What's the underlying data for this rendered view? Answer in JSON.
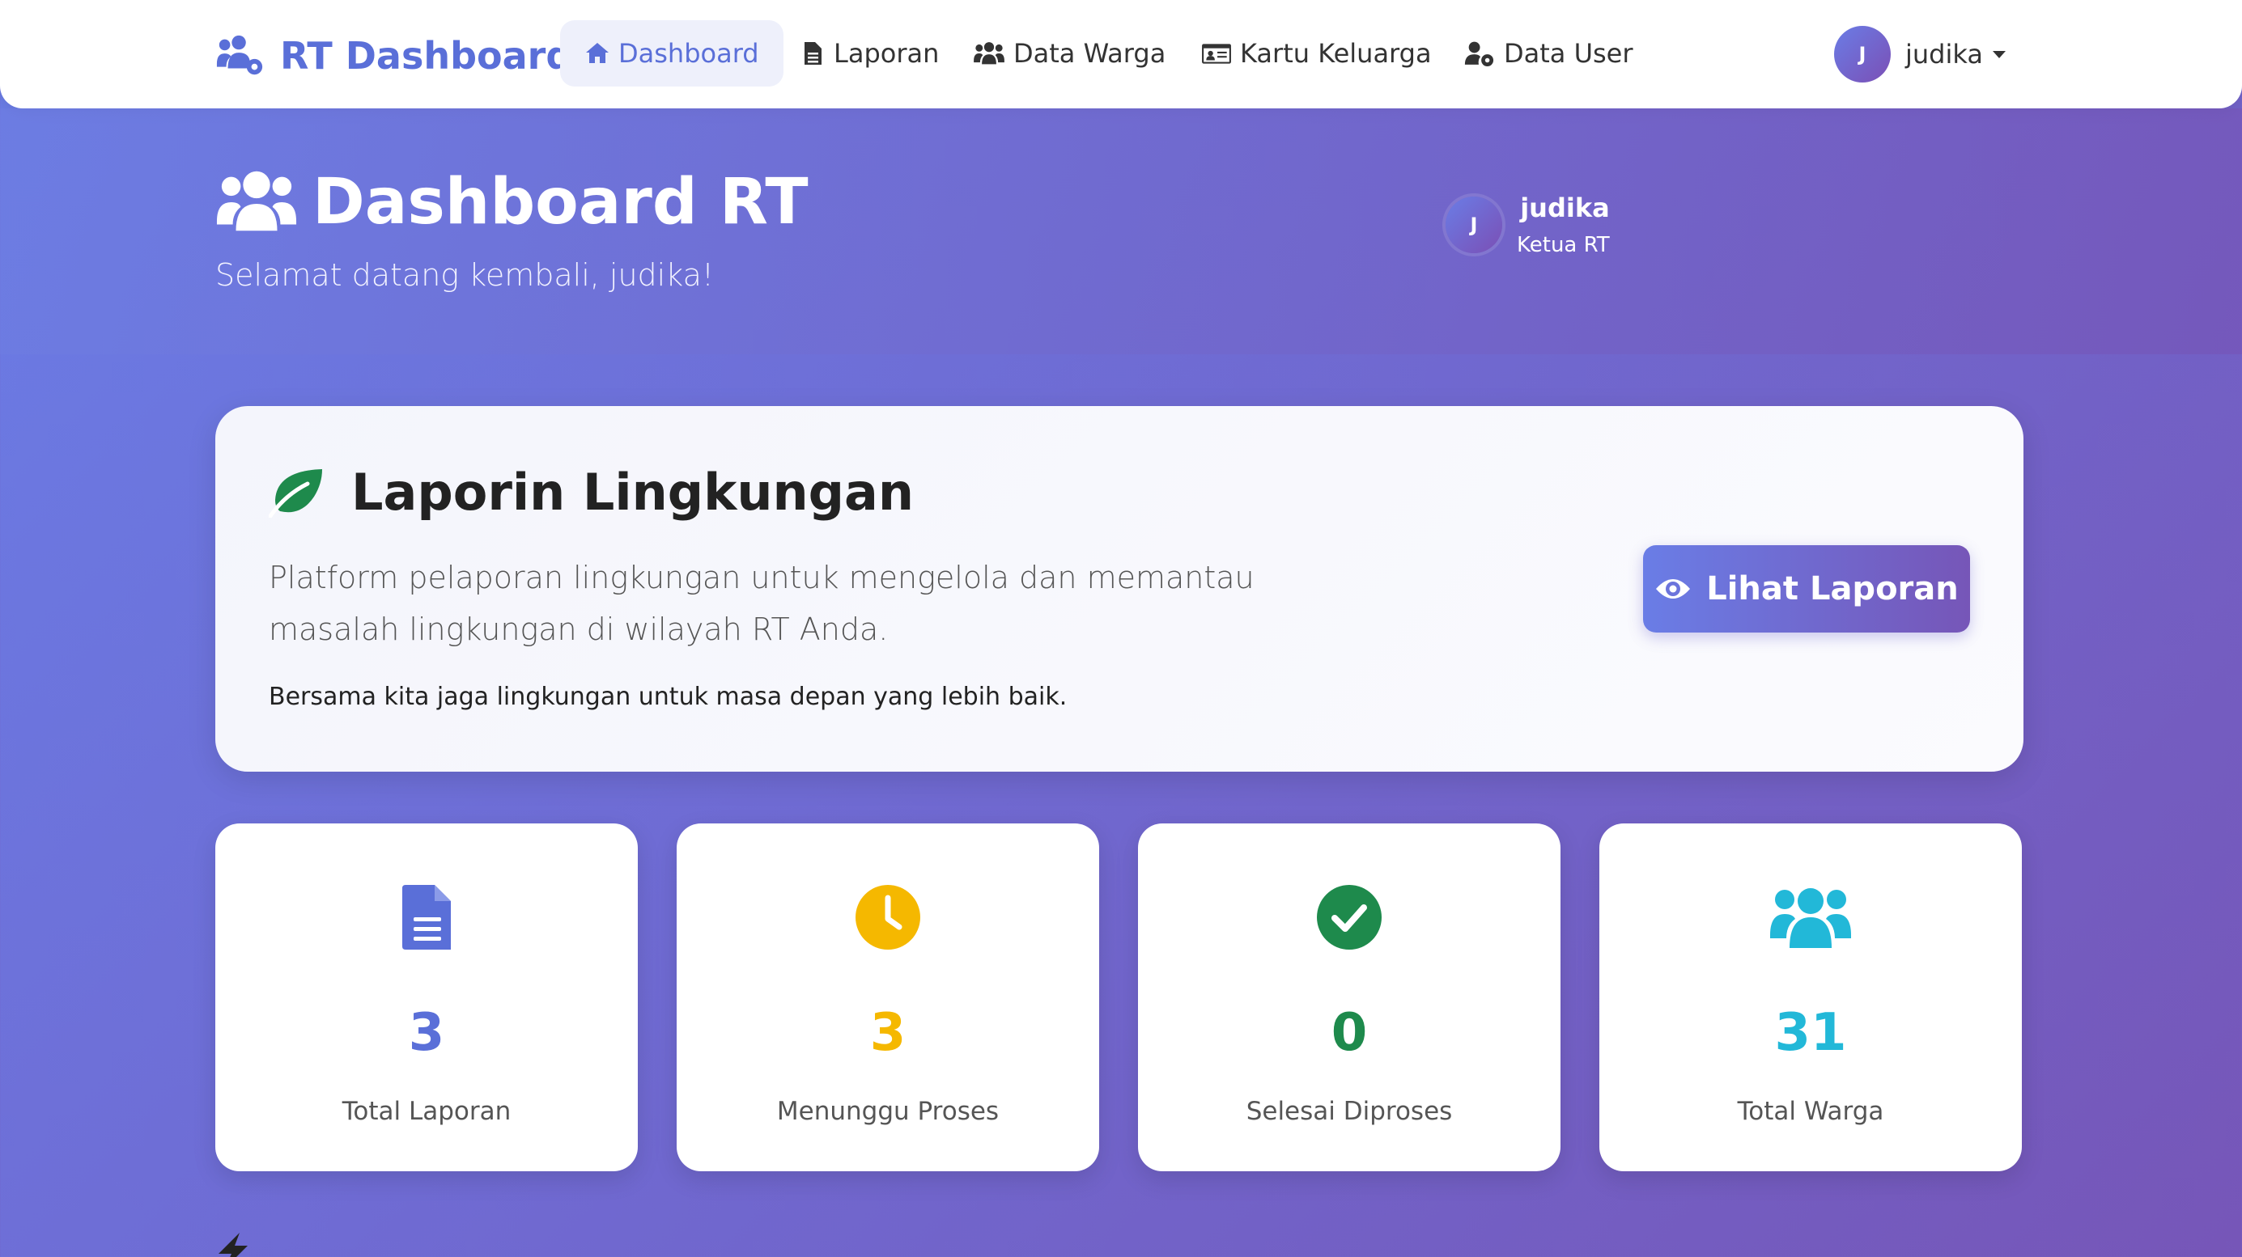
{
  "navbar": {
    "brand": "RT Dashboard",
    "items": [
      {
        "label": "Dashboard",
        "icon": "home-icon",
        "active": true
      },
      {
        "label": "Laporan",
        "icon": "file-icon",
        "active": false
      },
      {
        "label": "Data Warga",
        "icon": "users-icon",
        "active": false
      },
      {
        "label": "Kartu Keluarga",
        "icon": "id-card-icon",
        "active": false
      },
      {
        "label": "Data User",
        "icon": "user-cog-icon",
        "active": false
      }
    ],
    "user": {
      "initial": "J",
      "name": "judika"
    }
  },
  "header": {
    "title": "Dashboard RT",
    "welcome": "Selamat datang kembali, judika!",
    "user": {
      "initial": "J",
      "name": "judika",
      "role": "Ketua RT"
    }
  },
  "hero": {
    "title": "Laporin Lingkungan",
    "description": "Platform pelaporan lingkungan untuk mengelola dan memantau masalah lingkungan di wilayah RT Anda.",
    "note": "Bersama kita jaga lingkungan untuk masa depan yang lebih baik.",
    "button_label": "Lihat Laporan"
  },
  "stats": [
    {
      "value": "3",
      "label": "Total Laporan",
      "color": "#5a6fd8",
      "icon": "file-icon"
    },
    {
      "value": "3",
      "label": "Menunggu Proses",
      "color": "#f5b800",
      "icon": "clock-icon"
    },
    {
      "value": "0",
      "label": "Selesai Diproses",
      "color": "#1e8a4c",
      "icon": "check-circle-icon"
    },
    {
      "value": "31",
      "label": "Total Warga",
      "color": "#22b8d8",
      "icon": "users-icon"
    }
  ],
  "colors": {
    "accent": "#5a6fd8",
    "leaf": "#1e8a4c"
  }
}
